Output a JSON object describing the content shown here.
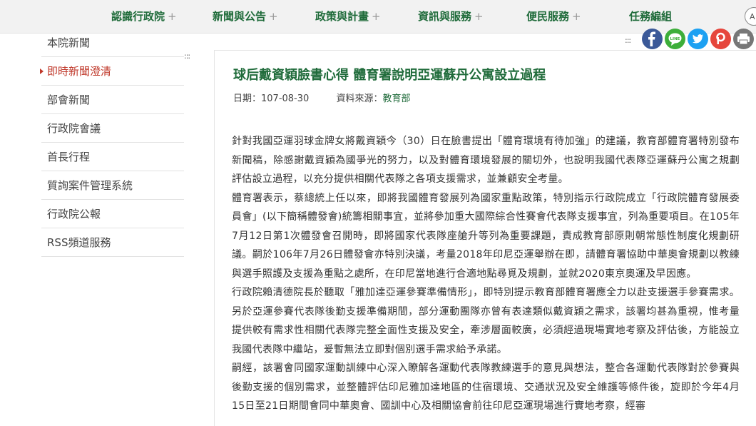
{
  "nav": {
    "items": [
      {
        "label": "認識行政院",
        "plus": "+"
      },
      {
        "label": "新聞與公告",
        "plus": "+"
      },
      {
        "label": "政策與計畫",
        "plus": "+"
      },
      {
        "label": "資訊與服務",
        "plus": "+"
      },
      {
        "label": "便民服務",
        "plus": "+"
      },
      {
        "label": "任務編組",
        "plus": ""
      }
    ],
    "font_size_button": "A"
  },
  "sidebar": {
    "items": [
      {
        "label": "本院新聞"
      },
      {
        "label": "即時新聞澄清"
      },
      {
        "label": "部會新聞"
      },
      {
        "label": "行政院會議"
      },
      {
        "label": "首長行程"
      },
      {
        "label": "質詢案件管理系統"
      },
      {
        "label": "行政院公報"
      },
      {
        "label": "RSS頻道服務"
      }
    ],
    "active_index": 1
  },
  "dots": ":::",
  "share": {
    "icons": [
      "facebook-icon",
      "line-icon",
      "twitter-icon",
      "plurk-icon",
      "print-icon"
    ],
    "colors": [
      "#3b5998",
      "#3dae3a",
      "#1da1f2",
      "#e6463c",
      "#777777"
    ],
    "line_text": "LINE"
  },
  "article": {
    "title": "球后戴資穎臉書心得 體育署說明亞運蘇丹公寓設立過程",
    "date_label": "日期：",
    "date": "107-08-30",
    "source_label": "資料來源：",
    "source": "教育部",
    "paragraphs": [
      "針對我國亞運羽球金牌女將戴資穎今（30）日在臉書提出「體育環境有待加強」的建議，教育部體育署特別發布新聞稿，除感謝戴資穎為國爭光的努力，以及對體育環境發展的關切外，也說明我國代表隊亞運蘇丹公寓之規劃評估設立過程，以充分提供相關代表隊之各項支援需求，並兼顧安全考量。",
      "體育署表示，蔡總統上任以來，即將我國體育發展列為國家重點政策，特別指示行政院成立「行政院體育發展委員會」(以下簡稱體發會)統籌相關事宜，並將參加重大國際綜合性賽會代表隊支援事宜，列為重要項目。在105年7月12日第1次體發會召開時，即將國家代表隊座艙升等列為重要課題，責成教育部原則朝常態性制度化規劃研議。嗣於106年7月26日體發會亦特別決議，考量2018年印尼亞運舉辦在即，請體育署協助中華奧會規劃以教練與選手照護及支援為重點之處所，在印尼當地進行合適地點尋覓及規劃，並就2020東京奧運及早因應。",
      "行政院賴清德院長於聽取「雅加達亞運參賽準備情形」，即特別提示教育部體育署應全力以赴支援選手參賽需求。另於亞運參賽代表隊後勤支援準備期間，部分運動團隊亦曾有表達類似戴資穎之需求，該署均甚為重視，惟考量提供較有需求性相關代表隊完整全面性支援及安全，牽涉層面較廣，必須經過現場實地考察及評估後，方能設立我國代表隊中繼站，爰暫無法立即對個別選手需求給予承諾。",
      "嗣經，該署會同國家運動訓練中心深入瞭解各運動代表隊教練選手的意見與想法，整合各運動代表隊對於參賽與後勤支援的個別需求，並整體評估印尼雅加達地區的住宿環境、交通狀況及安全維護等條件後，旋即於今年4月15日至21日期間會同中華奧會、國訓中心及相關協會前往印尼亞運現場進行實地考察，經審"
    ]
  }
}
